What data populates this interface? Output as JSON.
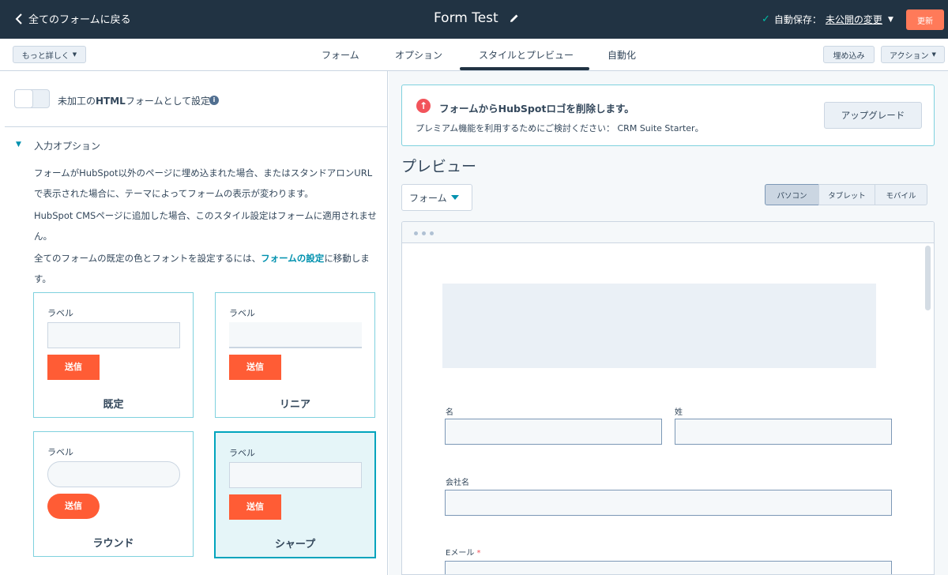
{
  "header": {
    "back_label": "全てのフォームに戻る",
    "title": "Form Test",
    "autosave_prefix": "自動保存：",
    "autosave_link": "未公開の変更",
    "update_label": "更新"
  },
  "tabbar": {
    "more_label": "もっと詳しく",
    "tabs": [
      {
        "label": "フォーム"
      },
      {
        "label": "オプション"
      },
      {
        "label": "スタイルとプレビュー",
        "active": true
      },
      {
        "label": "自動化"
      }
    ],
    "embed_label": "埋め込み",
    "action_label": "アクション"
  },
  "left": {
    "raw_html_prefix": "未加工の",
    "raw_html_bold": "HTML",
    "raw_html_suffix": "フォームとして設定",
    "raw_html_enabled": false,
    "section_title": "入力オプション",
    "para1": "フォームがHubSpot以外のページに埋め込まれた場合、またはスタンドアロンURLで表示された場合に、テーマによってフォームの表示が変わります。",
    "para2": "HubSpot CMSページに追加した場合、このスタイル設定はフォームに適用されません。",
    "para3_prefix": "全てのフォームの既定の色とフォントを設定するには、",
    "para3_link": "フォームの設定",
    "para3_suffix": "に移動します。",
    "cards": [
      {
        "label": "ラベル",
        "submit": "送信",
        "name": "既定"
      },
      {
        "label": "ラベル",
        "submit": "送信",
        "name": "リニア"
      },
      {
        "label": "ラベル",
        "submit": "送信",
        "name": "ラウンド"
      },
      {
        "label": "ラベル",
        "submit": "送信",
        "name": "シャープ",
        "selected": true
      }
    ]
  },
  "right": {
    "upgrade_title": "フォームからHubSpotロゴを削除します。",
    "upgrade_desc": "プレミアム機能を利用するためにご検討ください： CRM Suite Starter。",
    "upgrade_button": "アップグレード",
    "preview_title": "プレビュー",
    "form_select": "フォーム",
    "devices": [
      {
        "label": "パソコン",
        "active": true
      },
      {
        "label": "タブレット"
      },
      {
        "label": "モバイル"
      }
    ],
    "fields": {
      "first_name": "名",
      "last_name": "姓",
      "company": "会社名",
      "email": "Eメール",
      "required_mark": "*"
    }
  },
  "colors": {
    "header_bg": "#213343",
    "accent_orange": "#ff7a59",
    "submit_orange": "#ff5c35",
    "link_teal": "#0091ae",
    "selected_card_bg": "#e5f5f8",
    "selected_card_border": "#00a4bd"
  }
}
